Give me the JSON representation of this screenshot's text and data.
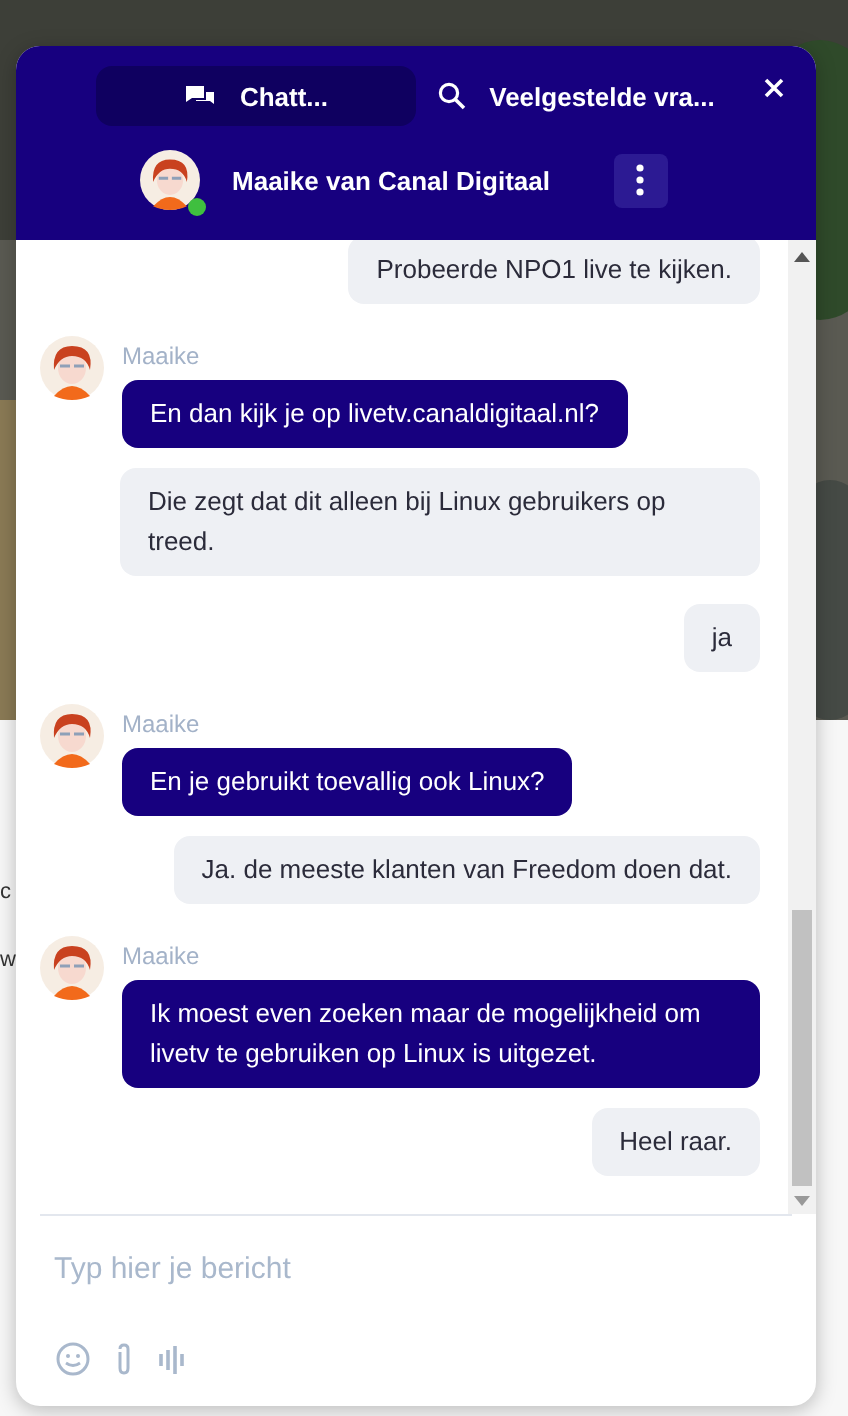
{
  "background_text": [
    "c",
    "w"
  ],
  "tabs": [
    {
      "label": "Chatt...",
      "selected": true
    },
    {
      "label": "Veelgestelde vra...",
      "selected": false
    }
  ],
  "agent": {
    "name": "Maaike van Canal Digitaal",
    "online": true
  },
  "messages": [
    {
      "kind": "user",
      "text": "Probeerde NPO1 live te kijken."
    },
    {
      "kind": "agent",
      "sender": "Maaike",
      "text": "En dan kijk je op livetv.canaldigitaal.nl?"
    },
    {
      "kind": "user",
      "text": "Die zegt dat dit alleen bij Linux gebruikers op treed."
    },
    {
      "kind": "user",
      "text": "ja"
    },
    {
      "kind": "agent",
      "sender": "Maaike",
      "text": "En je gebruikt toevallig ook Linux?"
    },
    {
      "kind": "user",
      "text": "Ja. de meeste klanten van Freedom doen dat."
    },
    {
      "kind": "agent",
      "sender": "Maaike",
      "text": "Ik moest even zoeken maar de mogelijkheid om livetv te gebruiken op Linux is uitgezet."
    },
    {
      "kind": "user",
      "text": "Heel raar."
    }
  ],
  "composer": {
    "placeholder": "Typ hier je bericht"
  }
}
